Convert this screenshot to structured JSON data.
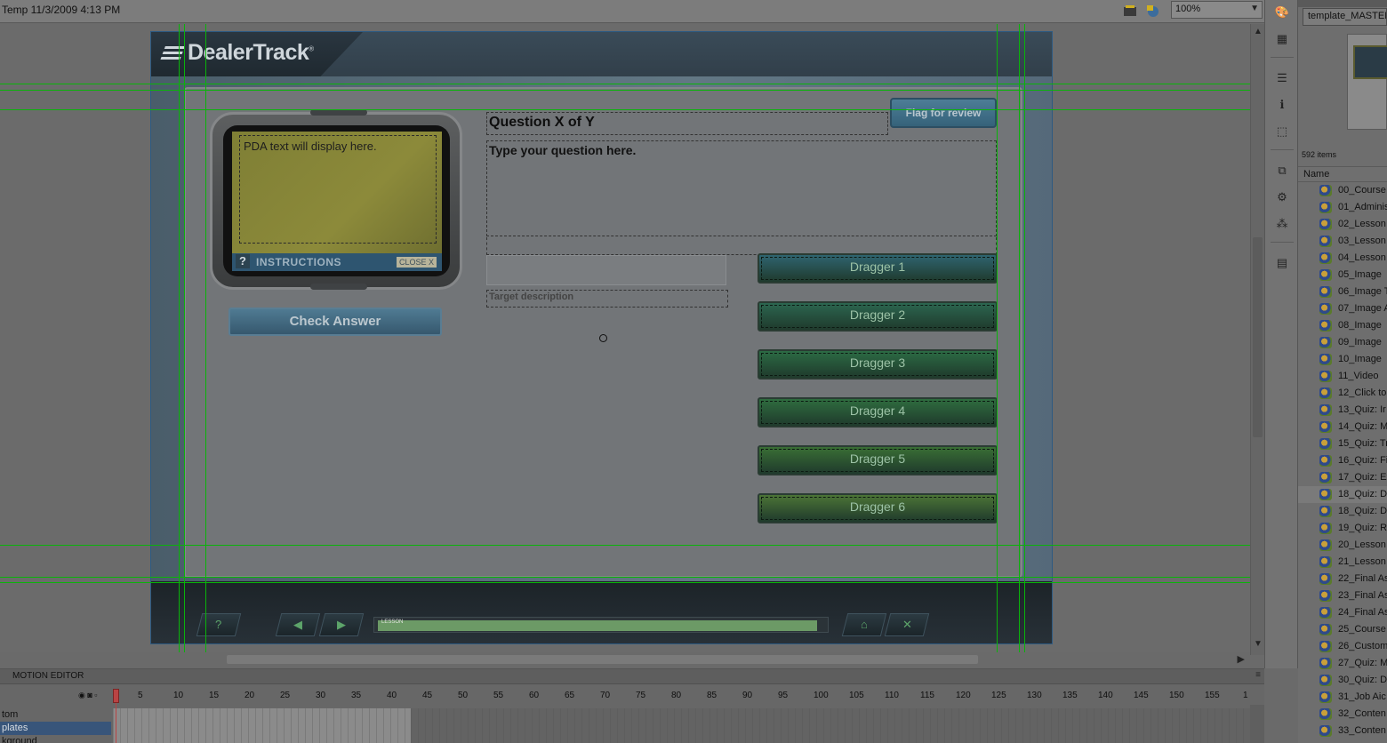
{
  "document": {
    "title": "Temp 11/3/2009 4:13 PM",
    "zoom": "100%"
  },
  "course": {
    "logo": "DealerTrack",
    "logo_mark": "®",
    "pda_text": "PDA text will display here.",
    "pda_help": "?",
    "instructions_label": "INSTRUCTIONS",
    "close_label": "CLOSE X",
    "check_answer_label": "Check Answer",
    "question_title": "Question X of Y",
    "flag_label": "Flag for review",
    "question_text": "Type your question here.",
    "target_description": "Target description",
    "draggers": [
      {
        "label": "Dragger 1",
        "color": "#2f6470"
      },
      {
        "label": "Dragger 2",
        "color": "#2c6650"
      },
      {
        "label": "Dragger 3",
        "color": "#2c6b44"
      },
      {
        "label": "Dragger 4",
        "color": "#2f6d3f"
      },
      {
        "label": "Dragger 5",
        "color": "#3a6f35"
      },
      {
        "label": "Dragger 6",
        "color": "#4c7436"
      }
    ],
    "nav": {
      "help": "?",
      "back": "◀",
      "next": "▶",
      "progress_label": "LESSON",
      "progress": 0.98,
      "home": "⌂",
      "exit": "✕"
    }
  },
  "library": {
    "document_select": "template_MASTER",
    "item_count": "592 items",
    "column_name": "Name",
    "items": [
      "00_Course",
      "01_Adminis",
      "02_Lesson",
      "03_Lesson",
      "04_Lesson",
      "05_Image",
      "06_Image T",
      "07_Image A",
      "08_Image",
      "09_Image",
      "10_Image",
      "11_Video",
      "12_Click to",
      "13_Quiz: Ir",
      "14_Quiz: M",
      "15_Quiz: Tr",
      "16_Quiz: Fi",
      "17_Quiz: Ex",
      "18_Quiz: D",
      "18_Quiz: D",
      "19_Quiz: R",
      "20_Lesson",
      "21_Lesson",
      "22_Final As",
      "23_Final As",
      "24_Final As",
      "25_Course",
      "26_Custom",
      "27_Quiz: M",
      "30_Quiz: D",
      "31_Job Aic",
      "32_Conten",
      "33_Conten"
    ],
    "selected_index": 18
  },
  "timeline": {
    "tab_label": "MOTION EDITOR",
    "menu": "≡",
    "frame_numbers": [
      "1",
      "5",
      "10",
      "15",
      "20",
      "25",
      "30",
      "35",
      "40",
      "45",
      "50",
      "55",
      "60",
      "65",
      "70",
      "75",
      "80",
      "85",
      "90",
      "95",
      "100",
      "105",
      "110",
      "115",
      "120",
      "125",
      "130",
      "135",
      "140",
      "145",
      "150",
      "155",
      "1"
    ],
    "layers": [
      "tom",
      "plates",
      "kground"
    ],
    "selected_layer": 1,
    "eye_icons": "◉ ◙ ▫"
  }
}
